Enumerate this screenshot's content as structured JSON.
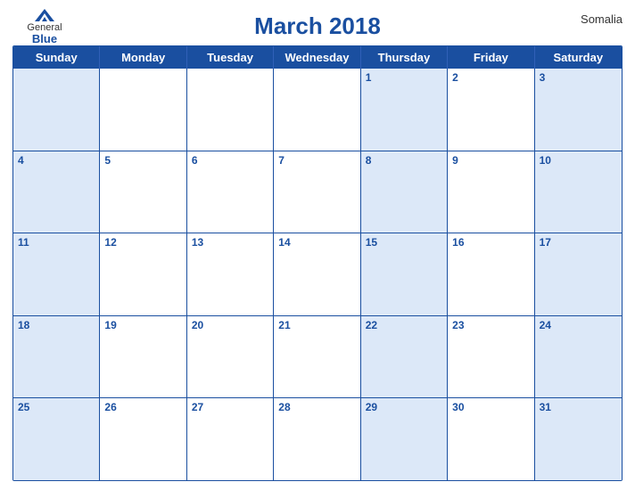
{
  "header": {
    "title": "March 2018",
    "country": "Somalia",
    "logo": {
      "general": "General",
      "blue": "Blue"
    }
  },
  "days_of_week": [
    "Sunday",
    "Monday",
    "Tuesday",
    "Wednesday",
    "Thursday",
    "Friday",
    "Saturday"
  ],
  "weeks": [
    [
      {
        "day": "",
        "shaded": true
      },
      {
        "day": "",
        "shaded": false
      },
      {
        "day": "",
        "shaded": false
      },
      {
        "day": "",
        "shaded": false
      },
      {
        "day": "1",
        "shaded": true
      },
      {
        "day": "2",
        "shaded": false
      },
      {
        "day": "3",
        "shaded": true
      }
    ],
    [
      {
        "day": "4",
        "shaded": true
      },
      {
        "day": "5",
        "shaded": false
      },
      {
        "day": "6",
        "shaded": false
      },
      {
        "day": "7",
        "shaded": false
      },
      {
        "day": "8",
        "shaded": true
      },
      {
        "day": "9",
        "shaded": false
      },
      {
        "day": "10",
        "shaded": true
      }
    ],
    [
      {
        "day": "11",
        "shaded": true
      },
      {
        "day": "12",
        "shaded": false
      },
      {
        "day": "13",
        "shaded": false
      },
      {
        "day": "14",
        "shaded": false
      },
      {
        "day": "15",
        "shaded": true
      },
      {
        "day": "16",
        "shaded": false
      },
      {
        "day": "17",
        "shaded": true
      }
    ],
    [
      {
        "day": "18",
        "shaded": true
      },
      {
        "day": "19",
        "shaded": false
      },
      {
        "day": "20",
        "shaded": false
      },
      {
        "day": "21",
        "shaded": false
      },
      {
        "day": "22",
        "shaded": true
      },
      {
        "day": "23",
        "shaded": false
      },
      {
        "day": "24",
        "shaded": true
      }
    ],
    [
      {
        "day": "25",
        "shaded": true
      },
      {
        "day": "26",
        "shaded": false
      },
      {
        "day": "27",
        "shaded": false
      },
      {
        "day": "28",
        "shaded": false
      },
      {
        "day": "29",
        "shaded": true
      },
      {
        "day": "30",
        "shaded": false
      },
      {
        "day": "31",
        "shaded": true
      }
    ]
  ]
}
